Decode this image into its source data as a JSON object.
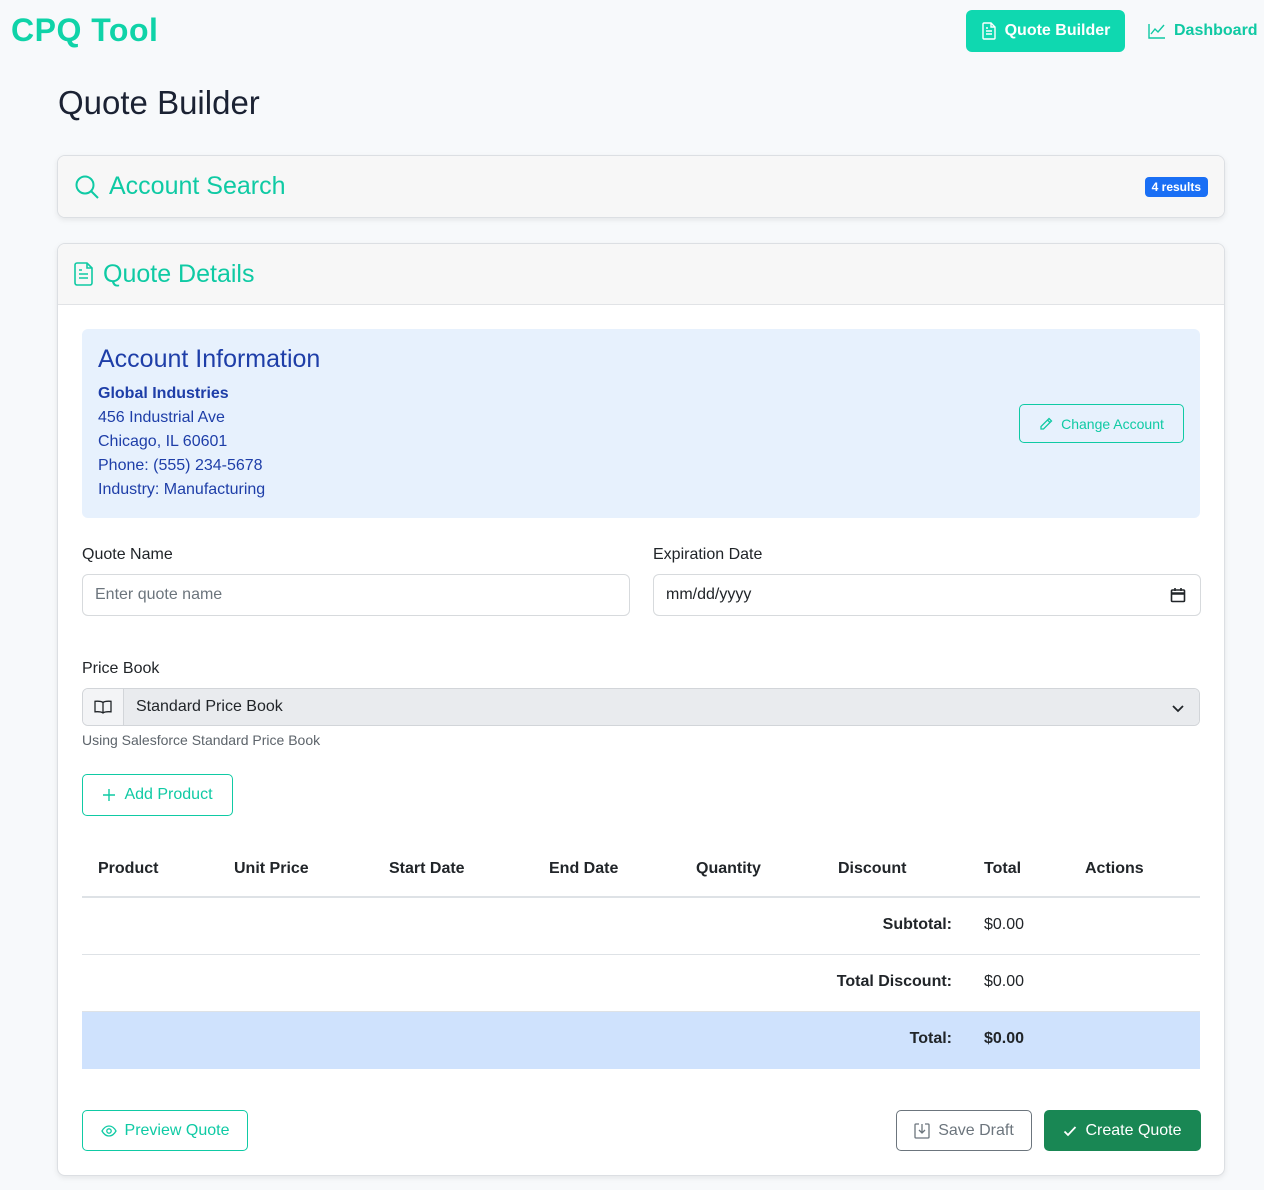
{
  "header": {
    "brand": "CPQ Tool",
    "nav_primary": "Quote Builder",
    "nav_dashboard": "Dashboard"
  },
  "page": {
    "title": "Quote Builder"
  },
  "account_search": {
    "title": "Account Search",
    "results_badge": "4 results"
  },
  "quote_details": {
    "title": "Quote Details",
    "account": {
      "heading": "Account Information",
      "name": "Global Industries",
      "address": "456 Industrial Ave",
      "city": "Chicago, IL 60601",
      "phone": "Phone: (555) 234-5678",
      "industry": "Industry: Manufacturing",
      "change_button": "Change Account"
    },
    "quote_name": {
      "label": "Quote Name",
      "placeholder": "Enter quote name",
      "value": ""
    },
    "expiration": {
      "label": "Expiration Date",
      "value": "mm/dd/yyyy"
    },
    "price_book": {
      "label": "Price Book",
      "selected": "Standard Price Book",
      "help": "Using Salesforce Standard Price Book"
    },
    "add_product": "Add Product",
    "table": {
      "columns": [
        "Product",
        "Unit Price",
        "Start Date",
        "End Date",
        "Quantity",
        "Discount",
        "Total",
        "Actions"
      ],
      "rows": []
    },
    "summary": {
      "subtotal_label": "Subtotal:",
      "subtotal_value": "$0.00",
      "discount_label": "Total Discount:",
      "discount_value": "$0.00",
      "total_label": "Total:",
      "total_value": "$0.00"
    },
    "actions": {
      "preview": "Preview Quote",
      "save_draft": "Save Draft",
      "create": "Create Quote"
    }
  },
  "colors": {
    "accent": "#0fd3a8",
    "badge": "#1a6ff5",
    "account_bg": "#e7f1fd",
    "account_text": "#1e3ea8",
    "total_row": "#cfe2fd",
    "create_button": "#198754"
  }
}
